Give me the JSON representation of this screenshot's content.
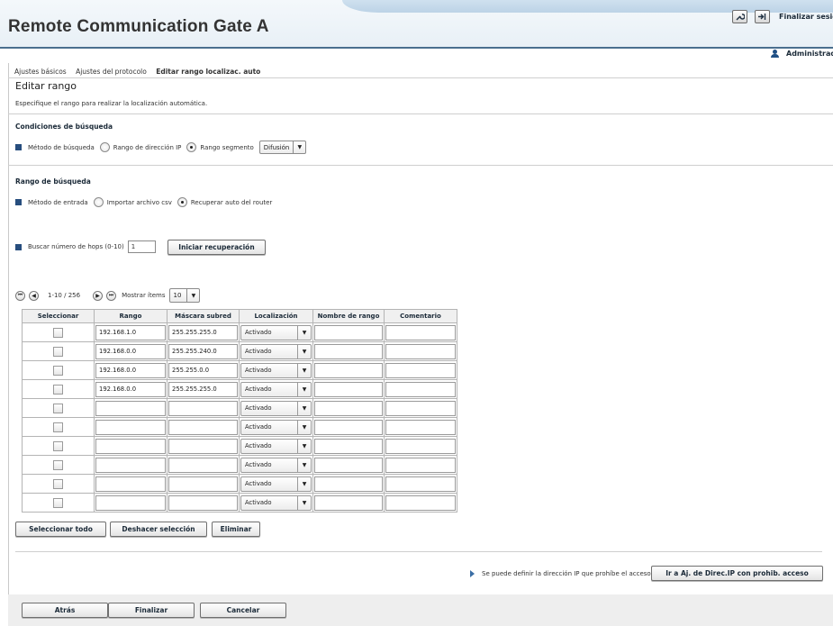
{
  "header": {
    "title": "Remote Communication Gate A",
    "logout_label": "Finalizar sesión",
    "user_label": "Administrador",
    "tools": [
      {
        "icon": "wrench-icon",
        "glyph": "🔧"
      },
      {
        "icon": "logout-arrow-icon",
        "glyph": "➜"
      }
    ]
  },
  "breadcrumb": [
    "Ajustes básicos",
    "Ajustes del protocolo",
    "Editar rango localizac. auto"
  ],
  "page": {
    "title": "Editar rango",
    "description": "Especifique el rango para realizar la localización automática."
  },
  "search_conditions": {
    "title": "Condiciones de búsqueda",
    "method_label": "Método de búsqueda",
    "option_ip": "Rango de dirección IP",
    "option_segment": "Rango segmento",
    "selected": "segment",
    "segment_select": "Difusión"
  },
  "search_range": {
    "title": "Rango de búsqueda",
    "input_method_label": "Método de entrada",
    "option_csv": "Importar archivo csv",
    "option_router": "Recuperar auto del router",
    "selected": "router",
    "hops_label": "Buscar número de hops (0-10)",
    "hops_value": "1",
    "start_button": "Iniciar recuperación"
  },
  "pager": {
    "range_text": "1-10 / 256",
    "show_items_label": "Mostrar ítems",
    "items_per_page": "10"
  },
  "table": {
    "headers": [
      "Seleccionar",
      "Rango",
      "Máscara subred",
      "Localización",
      "Nombre de rango",
      "Comentario"
    ],
    "rows": [
      {
        "range": "192.168.1.0",
        "mask": "255.255.255.0",
        "loc": "Activado",
        "name": "",
        "comment": ""
      },
      {
        "range": "192.168.0.0",
        "mask": "255.255.240.0",
        "loc": "Activado",
        "name": "",
        "comment": ""
      },
      {
        "range": "192.168.0.0",
        "mask": "255.255.0.0",
        "loc": "Activado",
        "name": "",
        "comment": ""
      },
      {
        "range": "192.168.0.0",
        "mask": "255.255.255.0",
        "loc": "Activado",
        "name": "",
        "comment": ""
      },
      {
        "range": "",
        "mask": "",
        "loc": "Activado",
        "name": "",
        "comment": ""
      },
      {
        "range": "",
        "mask": "",
        "loc": "Activado",
        "name": "",
        "comment": ""
      },
      {
        "range": "",
        "mask": "",
        "loc": "Activado",
        "name": "",
        "comment": ""
      },
      {
        "range": "",
        "mask": "",
        "loc": "Activado",
        "name": "",
        "comment": ""
      },
      {
        "range": "",
        "mask": "",
        "loc": "Activado",
        "name": "",
        "comment": ""
      },
      {
        "range": "",
        "mask": "",
        "loc": "Activado",
        "name": "",
        "comment": ""
      }
    ]
  },
  "table_actions": {
    "select_all": "Seleccionar todo",
    "deselect": "Deshacer selección",
    "delete": "Eliminar"
  },
  "note": {
    "text": "Se puede definir la dirección IP que prohíbe el acceso.",
    "button": "Ir a Aj. de Direc.IP con prohib. acceso"
  },
  "footer": {
    "back": "Atrás",
    "finish": "Finalizar",
    "cancel": "Cancelar"
  },
  "colors": {
    "accent": "#274e7e",
    "header_rule": "#4a6f8e"
  }
}
